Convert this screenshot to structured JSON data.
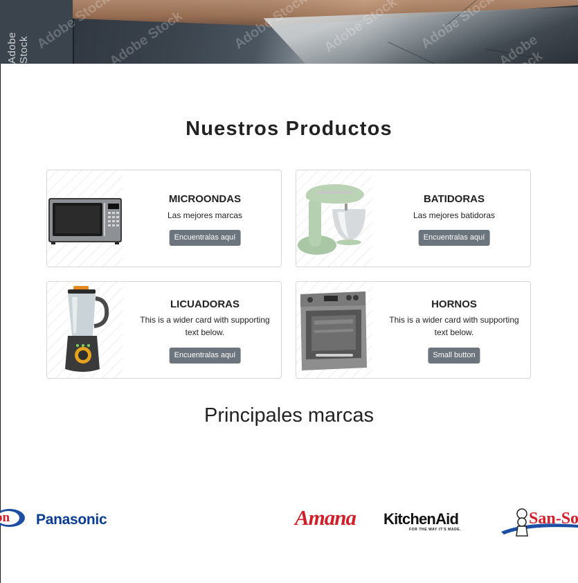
{
  "hero": {
    "watermark_side": "Adobe Stock",
    "watermark": "Adobe Stock"
  },
  "products": {
    "title": "Nuestros Productos",
    "cards": [
      {
        "title": "MICROONDAS",
        "text": "Las mejores marcas",
        "button": "Encuentralas aquí",
        "image": "microwave-image"
      },
      {
        "title": "BATIDORAS",
        "text": "Las mejores batidoras",
        "button": "Encuentralas aquí",
        "image": "stand-mixer-image"
      },
      {
        "title": "LICUADORAS",
        "text": "This is a wider card with supporting text below.",
        "button": "Encuentralas aquí",
        "image": "blender-image"
      },
      {
        "title": "HORNOS",
        "text": "This is a wider card with supporting text below.",
        "button": "Small button",
        "image": "oven-image"
      }
    ]
  },
  "brands": {
    "title": "Principales marcas",
    "logos": [
      {
        "name": "on",
        "text": "on"
      },
      {
        "name": "Panasonic",
        "text": "Panasonic"
      },
      {
        "name": "Amana",
        "text": "Amana"
      },
      {
        "name": "KitchenAid",
        "text": "KitchenAid",
        "tagline": "FOR THE WAY IT'S MADE."
      },
      {
        "name": "San-Son",
        "text": "San-So"
      }
    ]
  },
  "colors": {
    "button_bg": "#6c757d",
    "panasonic": "#0a3d91",
    "amana": "#d11f2a",
    "kitchenaid": "#111111",
    "sanson": "#d11f2a"
  }
}
